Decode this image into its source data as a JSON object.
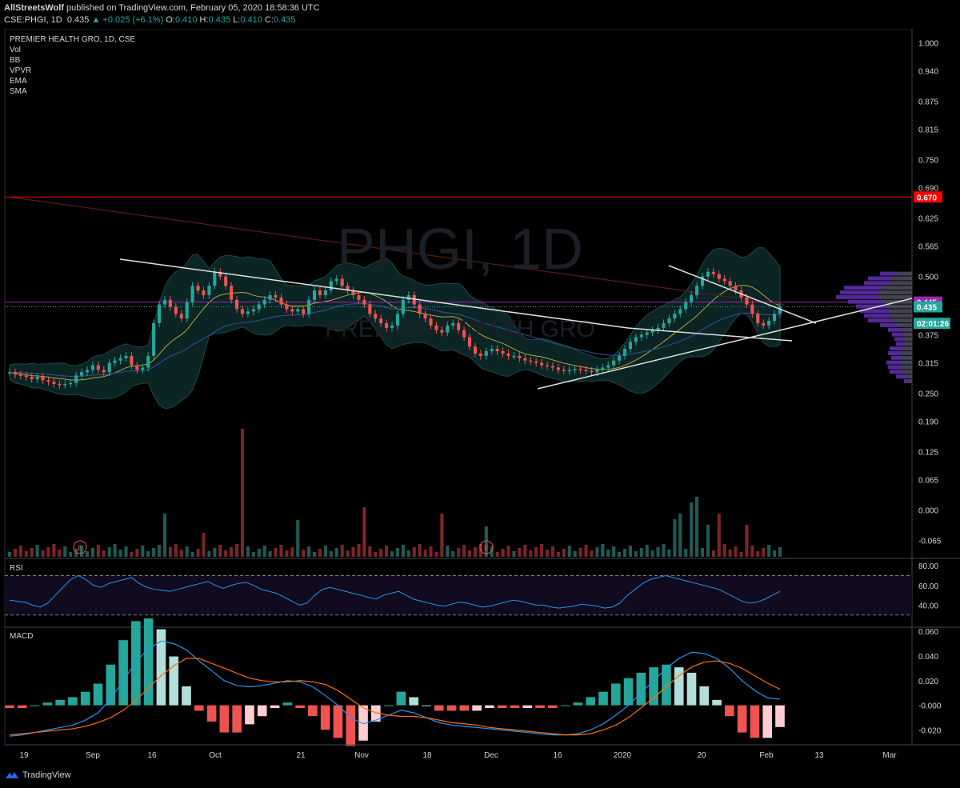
{
  "header": {
    "publisher": "AllStreetsWolf",
    "published_text": "published on TradingView.com, February 05, 2020 18:58:36 UTC",
    "symbol_line": "CSE:PHGI, 1D",
    "last": "0.435",
    "change": "+0.025 (+6.1%)",
    "ohlc": [
      {
        "label": "O:",
        "value": "0.410"
      },
      {
        "label": "H:",
        "value": "0.435"
      },
      {
        "label": "L:",
        "value": "0.410"
      },
      {
        "label": "C:",
        "value": "0.435"
      }
    ]
  },
  "legend": {
    "title": "PREMIER HEALTH GRO, 1D, CSE",
    "items": [
      "Vol",
      "BB",
      "VPVR",
      "EMA",
      "SMA"
    ]
  },
  "watermark": {
    "symbol": "PHGI, 1D",
    "name": "PREMIER HEALTH GRO"
  },
  "colors": {
    "up": "#26a69a",
    "down": "#ef5350",
    "red_line": "#ff0000",
    "purple_line": "#9c27b0",
    "bb_fill": "#0b2424",
    "rsi": "#2196f3",
    "macd_line": "#2196f3",
    "signal_line": "#ff6d00"
  },
  "chart_data": [
    {
      "type": "candlestick",
      "title": "PREMIER HEALTH GRO, 1D, CSE",
      "y_ticks": [
        "1.000",
        "0.940",
        "0.875",
        "0.815",
        "0.750",
        "0.690",
        "0.625",
        "0.565",
        "0.500",
        "0.375",
        "0.315",
        "0.250",
        "0.190",
        "0.125",
        "0.065",
        "0.000",
        "-0.065"
      ],
      "x_ticks": [
        "19",
        "Sep",
        "16",
        "Oct",
        "21",
        "Nov",
        "18",
        "Dec",
        "16",
        "2020",
        "20",
        "Feb",
        "13",
        "Mar"
      ],
      "price_labels": [
        {
          "text": "0.670",
          "color": "#ff0000"
        },
        {
          "text": "0.445",
          "color": "#9c27b0"
        },
        {
          "text": "0.435",
          "color": "#26a69a"
        },
        {
          "text": "02:01:26",
          "color": "#26a69a"
        }
      ],
      "horizontal_levels": [
        0.67,
        0.445,
        0.435
      ],
      "close": [
        0.295,
        0.29,
        0.288,
        0.285,
        0.28,
        0.285,
        0.278,
        0.275,
        0.27,
        0.268,
        0.27,
        0.272,
        0.288,
        0.295,
        0.3,
        0.31,
        0.3,
        0.295,
        0.315,
        0.32,
        0.325,
        0.33,
        0.31,
        0.3,
        0.305,
        0.33,
        0.4,
        0.44,
        0.45,
        0.435,
        0.42,
        0.41,
        0.445,
        0.48,
        0.47,
        0.46,
        0.48,
        0.51,
        0.5,
        0.48,
        0.45,
        0.43,
        0.42,
        0.425,
        0.43,
        0.44,
        0.45,
        0.46,
        0.455,
        0.44,
        0.43,
        0.425,
        0.43,
        0.42,
        0.45,
        0.47,
        0.46,
        0.47,
        0.49,
        0.495,
        0.48,
        0.47,
        0.46,
        0.45,
        0.44,
        0.42,
        0.41,
        0.4,
        0.39,
        0.395,
        0.42,
        0.45,
        0.46,
        0.44,
        0.42,
        0.41,
        0.395,
        0.385,
        0.38,
        0.395,
        0.4,
        0.385,
        0.37,
        0.35,
        0.335,
        0.33,
        0.34,
        0.345,
        0.34,
        0.335,
        0.33,
        0.33,
        0.325,
        0.32,
        0.318,
        0.315,
        0.31,
        0.308,
        0.305,
        0.3,
        0.298,
        0.3,
        0.302,
        0.3,
        0.298,
        0.295,
        0.3,
        0.305,
        0.31,
        0.32,
        0.33,
        0.345,
        0.36,
        0.37,
        0.375,
        0.38,
        0.385,
        0.39,
        0.4,
        0.41,
        0.42,
        0.43,
        0.445,
        0.46,
        0.48,
        0.5,
        0.51,
        0.505,
        0.495,
        0.49,
        0.48,
        0.47,
        0.455,
        0.44,
        0.42,
        0.4,
        0.395,
        0.405,
        0.42,
        0.435
      ],
      "trendlines": [
        {
          "from": [
            0.545,
            "Aug"
          ],
          "to": [
            0.41,
            "Jan"
          ]
        },
        {
          "from": [
            0.26,
            "Dec"
          ],
          "to": [
            0.445,
            "Mar"
          ]
        },
        {
          "from": [
            0.52,
            "Jan"
          ],
          "to": [
            0.405,
            "Feb"
          ]
        }
      ]
    },
    {
      "type": "line",
      "title": "RSI",
      "y_ticks": [
        "80.00",
        "60.00",
        "40.00"
      ],
      "levels": [
        70,
        30
      ],
      "values": [
        45,
        44,
        43,
        40,
        38,
        42,
        50,
        58,
        66,
        70,
        66,
        60,
        58,
        62,
        64,
        66,
        68,
        62,
        58,
        56,
        55,
        54,
        56,
        58,
        60,
        62,
        64,
        60,
        57,
        60,
        62,
        63,
        60,
        56,
        54,
        52,
        48,
        44,
        40,
        42,
        50,
        56,
        58,
        56,
        54,
        52,
        50,
        48,
        46,
        50,
        52,
        54,
        50,
        46,
        44,
        42,
        40,
        39,
        41,
        43,
        42,
        40,
        38,
        39,
        41,
        43,
        45,
        44,
        42,
        40,
        40,
        38,
        37,
        38,
        39,
        41,
        40,
        39,
        37,
        38,
        42,
        50,
        56,
        62,
        66,
        68,
        70,
        68,
        66,
        64,
        62,
        60,
        58,
        56,
        52,
        48,
        44,
        42,
        43,
        46,
        50,
        54
      ]
    },
    {
      "type": "bar+line",
      "title": "MACD",
      "y_ticks": [
        "0.060",
        "0.040",
        "0.020",
        "-0.000",
        "-0.020"
      ],
      "macd": [
        -0.025,
        -0.024,
        -0.022,
        -0.02,
        -0.018,
        -0.016,
        -0.012,
        -0.006,
        0.005,
        0.02,
        0.035,
        0.046,
        0.052,
        0.05,
        0.045,
        0.036,
        0.028,
        0.02,
        0.016,
        0.015,
        0.016,
        0.018,
        0.02,
        0.019,
        0.015,
        0.008,
        0.0,
        -0.01,
        -0.015,
        -0.012,
        -0.008,
        -0.004,
        -0.006,
        -0.01,
        -0.014,
        -0.016,
        -0.017,
        -0.018,
        -0.019,
        -0.02,
        -0.021,
        -0.022,
        -0.023,
        -0.024,
        -0.024,
        -0.023,
        -0.02,
        -0.015,
        -0.008,
        0.0,
        0.01,
        0.02,
        0.03,
        0.038,
        0.043,
        0.042,
        0.038,
        0.03,
        0.02,
        0.012,
        0.006,
        0.005
      ],
      "signal": [
        -0.024,
        -0.023,
        -0.022,
        -0.021,
        -0.02,
        -0.019,
        -0.017,
        -0.014,
        -0.01,
        -0.004,
        0.004,
        0.014,
        0.024,
        0.032,
        0.038,
        0.038,
        0.034,
        0.03,
        0.026,
        0.022,
        0.02,
        0.019,
        0.019,
        0.02,
        0.019,
        0.017,
        0.012,
        0.005,
        -0.002,
        -0.006,
        -0.008,
        -0.009,
        -0.009,
        -0.01,
        -0.012,
        -0.014,
        -0.015,
        -0.016,
        -0.018,
        -0.019,
        -0.02,
        -0.021,
        -0.022,
        -0.023,
        -0.024,
        -0.024,
        -0.023,
        -0.02,
        -0.016,
        -0.01,
        -0.002,
        0.006,
        0.015,
        0.024,
        0.031,
        0.035,
        0.036,
        0.034,
        0.03,
        0.024,
        0.018,
        0.013
      ]
    }
  ],
  "footer": {
    "brand": "TradingView"
  }
}
